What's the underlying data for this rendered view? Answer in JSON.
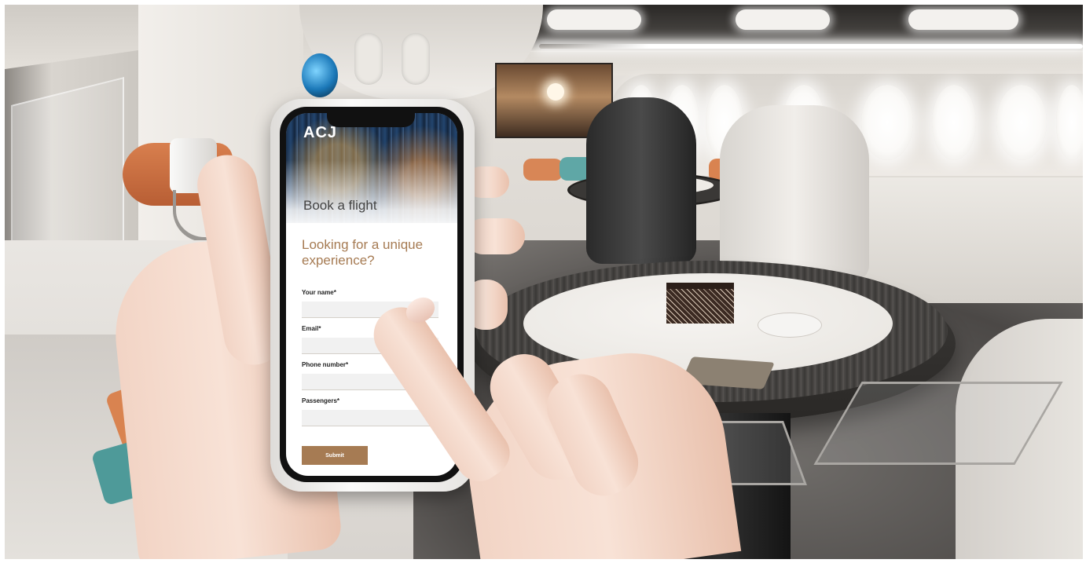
{
  "phone": {
    "logo_text": "ACJ",
    "hero_title": "Book a flight",
    "headline": "Looking for a unique experience?",
    "form": {
      "fields": [
        {
          "label": "Your name*",
          "value": ""
        },
        {
          "label": "Email*",
          "value": ""
        },
        {
          "label": "Phone number*",
          "value": ""
        },
        {
          "label": "Passengers*",
          "value": ""
        }
      ],
      "submit_label": "Submit"
    }
  },
  "colors": {
    "accent": "#a67b53",
    "field_bg": "#f1f1f1",
    "heading_gray": "#444444"
  },
  "icons": [
    "acj-logo"
  ]
}
